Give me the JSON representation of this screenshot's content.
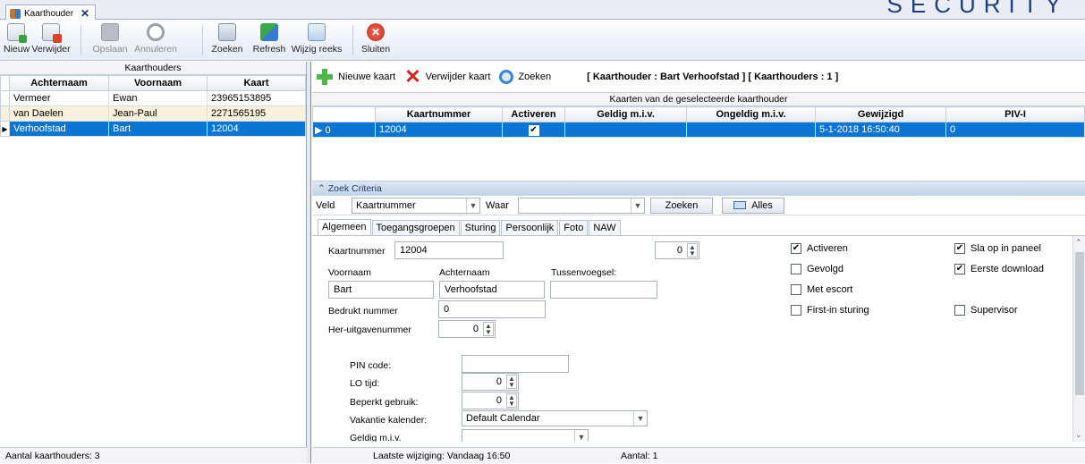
{
  "brand": "SECURITY",
  "doc_tab": {
    "label": "Kaarthouder",
    "close": "✕"
  },
  "toolbar": {
    "nieuw": "Nieuw",
    "verwijder": "Verwijder",
    "opslaan": "Opslaan",
    "annuleren": "Annuleren",
    "zoeken": "Zoeken",
    "refresh": "Refresh",
    "wijzig_reeks": "Wijzig reeks",
    "sluiten": "Sluiten"
  },
  "left": {
    "caption": "Kaarthouders",
    "columns": [
      "Achternaam",
      "Voornaam",
      "Kaart"
    ],
    "rows": [
      {
        "achternaam": "Vermeer",
        "voornaam": "Ewan",
        "kaart": "23965153895"
      },
      {
        "achternaam": "van Daelen",
        "voornaam": "Jean-Paul",
        "kaart": "2271565195"
      },
      {
        "achternaam": "Verhoofstad",
        "voornaam": "Bart",
        "kaart": "12004"
      }
    ],
    "footer": "Aantal kaarthouders: 3"
  },
  "right_toolbar": {
    "nieuwe_kaart": "Nieuwe kaart",
    "verwijder_kaart": "Verwijder kaart",
    "zoeken": "Zoeken",
    "info": "[ Kaarthouder : Bart Verhoofstad ]  [ Kaarthouders : 1 ]"
  },
  "cards": {
    "caption": "Kaarten van de geselecteerde kaarthouder",
    "columns": [
      "Kaartnummer",
      "Activeren",
      "Geldig m.i.v.",
      "Ongeldig m.i.v.",
      "Gewijzigd",
      "PIV-I"
    ],
    "row": {
      "index": "0",
      "kaartnummer": "12004",
      "activeren": "✔",
      "geldig": "",
      "ongeldig": "",
      "gewijzigd": "5-1-2018 16:50:40",
      "pivi": "0"
    }
  },
  "zoek": {
    "header": "Zoek Criteria",
    "veld_label": "Veld",
    "veld_value": "Kaartnummer",
    "waar_label": "Waar",
    "waar_value": "",
    "zoeken_btn": "Zoeken",
    "alles_btn": "Alles"
  },
  "tabs": [
    "Algemeen",
    "Toegangsgroepen",
    "Sturing",
    "Persoonlijk",
    "Foto",
    "NAW"
  ],
  "form": {
    "kaartnummer_label": "Kaartnummer",
    "kaartnummer": "12004",
    "spin_top": "0",
    "voornaam_label": "Voornaam",
    "voornaam": "Bart",
    "achternaam_label": "Achternaam",
    "achternaam": "Verhoofstad",
    "tussenvoegsel_label": "Tussenvoegsel:",
    "tussenvoegsel": "",
    "bedrukt_label": "Bedrukt nummer",
    "bedrukt": "0",
    "heruitgave_label": "Her-uitgavenummer",
    "heruitgave": "0",
    "pin_label": "PIN code:",
    "pin": "",
    "lo_label": "LO tijd:",
    "lo": "0",
    "beperkt_label": "Beperkt gebruik:",
    "beperkt": "0",
    "vakantie_label": "Vakantie kalender:",
    "vakantie": "Default Calendar",
    "geldig_label": "Geldig m.i.v.",
    "geldig": "",
    "chk_activeren": "Activeren",
    "chk_gevolgd": "Gevolgd",
    "chk_escort": "Met escort",
    "chk_firstin": "First-in sturing",
    "chk_slaop": "Sla op in paneel",
    "chk_eerste": "Eerste download",
    "chk_supervisor": "Supervisor"
  },
  "status": {
    "laatste": "Laatste wijziging: Vandaag 16:50",
    "aantal": "Aantal: 1"
  }
}
